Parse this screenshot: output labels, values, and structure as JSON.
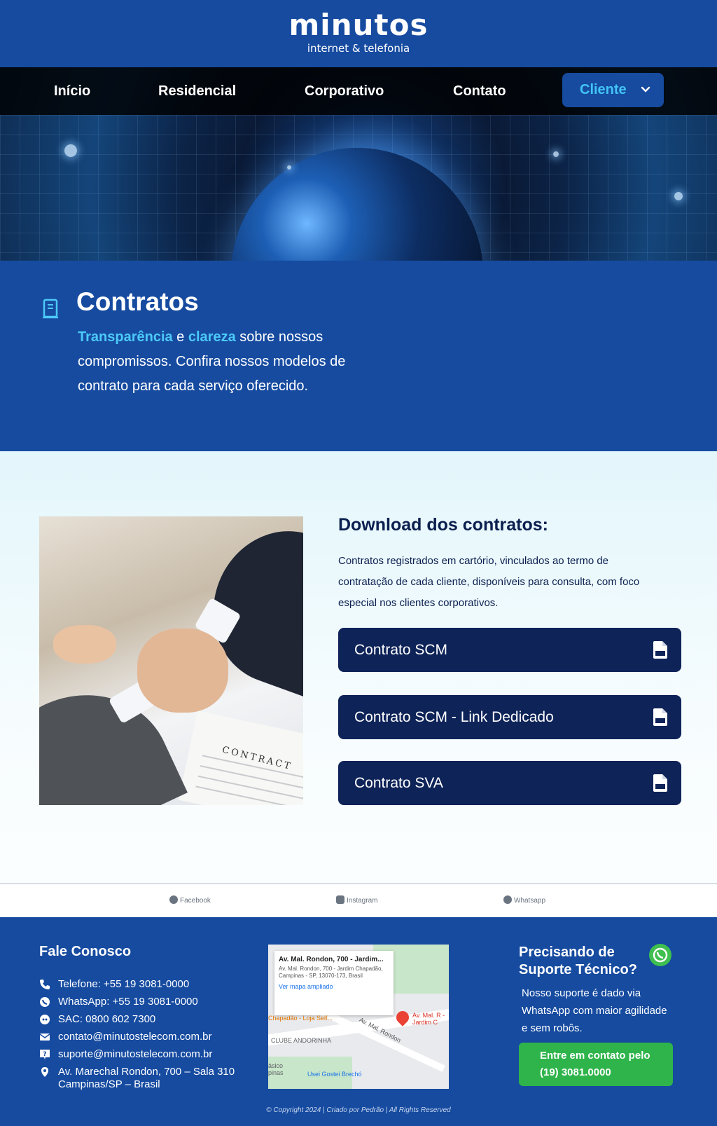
{
  "brand": {
    "logo_main": "minutos",
    "logo_sub": "internet & telefonia"
  },
  "nav": {
    "items": [
      "Início",
      "Residencial",
      "Corporativo",
      "Contato"
    ],
    "client_label": "Cliente"
  },
  "title_section": {
    "title": "Contratos",
    "intro_hl1": "Transparência",
    "intro_mid": " e ",
    "intro_hl2": "clareza",
    "intro_rest": " sobre nossos compromissos. Confira nossos modelos de contrato para cada serviço oferecido."
  },
  "downloads": {
    "title": "Download dos contratos:",
    "description": "Contratos registrados em cartório, vinculados ao termo de contratação de cada cliente, disponíveis para consulta, com foco especial nos clientes corporativos.",
    "buttons": [
      "Contrato SCM",
      "Contrato SCM - Link Dedicado",
      "Contrato SVA"
    ],
    "photo_text": "CONTRACT"
  },
  "social": {
    "items": [
      "Facebook",
      "Instagram",
      "Whatsapp"
    ]
  },
  "footer": {
    "contact_title": "Fale Conosco",
    "contacts": [
      {
        "icon": "phone-icon",
        "text": "Telefone: +55 19 3081-0000"
      },
      {
        "icon": "whatsapp-icon",
        "text": "WhatsApp: +55 19 3081-0000"
      },
      {
        "icon": "sac-icon",
        "text": "SAC: 0800 602 7300"
      },
      {
        "icon": "mail-icon",
        "text": "contato@minutostelecom.com.br"
      },
      {
        "icon": "support-icon",
        "text": "suporte@minutostelecom.com.br"
      },
      {
        "icon": "location-icon",
        "text": "Av. Marechal Rondon, 700 – Sala 310",
        "text2": "Campinas/SP – Brasil"
      }
    ],
    "map": {
      "card_title": "Av. Mal. Rondon, 700 - Jardim...",
      "card_address": "Av. Mal. Rondon, 700 - Jardim Chapadão, Campinas - SP, 13070-173, Brasil",
      "card_link": "Ver mapa ampliado",
      "labels": [
        "Chapadão - Loja Self...",
        "Av. Mal. Rondon",
        "CLUBE ANDORINHA",
        "Usei Gostei Brechó",
        "Av. Mal. R - Jardim C",
        "ásico pinas"
      ]
    },
    "support_title": "Precisando de Suporte Técnico?",
    "support_text": "Nosso suporte é dado via WhatsApp com maior agilidade e sem robôs.",
    "support_btn_line1": "Entre em contato pelo",
    "support_btn_line2": "(19) 3081.0000",
    "copyright": "© Copyright 2024 | Criado por Pedrão | All Rights Reserved"
  },
  "colors": {
    "brand_blue": "#164ba0",
    "navy": "#0e2358",
    "accent_cyan": "#4cc9f7",
    "whatsapp_green": "#2fb44b"
  }
}
